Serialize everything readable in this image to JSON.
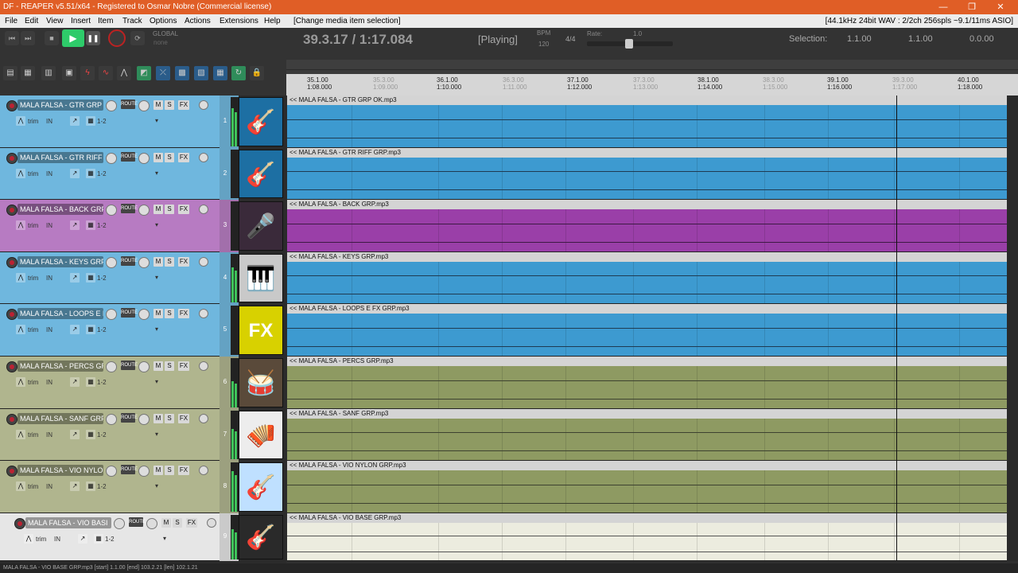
{
  "window": {
    "title": "DF - REAPER v5.51/x64 - Registered to Osmar Nobre (Commercial license)",
    "minimize": "—",
    "maximize": "❐",
    "close": "✕"
  },
  "menu": {
    "items": [
      "File",
      "Edit",
      "View",
      "Insert",
      "Item",
      "Track",
      "Options",
      "Actions",
      "Extensions",
      "Help",
      "[Change media item selection]"
    ],
    "audio_info": "[44.1kHz 24bit WAV : 2/2ch 256spls ~9.1/11ms ASIO]"
  },
  "transport": {
    "position": "39.3.17 / 1:17.084",
    "state": "[Playing]",
    "bpm_label": "BPM",
    "bpm": "120",
    "time_sig": "4/4",
    "rate_label": "Rate:",
    "rate": "1.0",
    "global_label": "GLOBAL",
    "global_sub": "none",
    "selection_label": "Selection:",
    "sel_start": "1.1.00",
    "sel_end": "1.1.00",
    "sel_len": "0.0.00"
  },
  "ruler": {
    "major": [
      {
        "bar": "35.1.00",
        "time": "1:08.000"
      },
      {
        "bar": "36.1.00",
        "time": "1:10.000"
      },
      {
        "bar": "37.1.00",
        "time": "1:12.000"
      },
      {
        "bar": "38.1.00",
        "time": "1:14.000"
      },
      {
        "bar": "39.1.00",
        "time": "1:16.000"
      },
      {
        "bar": "40.1.00",
        "time": "1:18.000"
      }
    ],
    "minor": [
      {
        "bar": "35.3.00",
        "time": "1:09.000"
      },
      {
        "bar": "36.3.00",
        "time": "1:11.000"
      },
      {
        "bar": "37.3.00",
        "time": "1:13.000"
      },
      {
        "bar": "38.3.00",
        "time": "1:15.000"
      },
      {
        "bar": "39.3.00",
        "time": "1:17.000"
      }
    ]
  },
  "track_ui": {
    "trim": "trim",
    "in": "IN",
    "io": "1-2",
    "m": "M",
    "s": "S",
    "fx": "FX",
    "route": "ROUTE"
  },
  "tracks": [
    {
      "num": "1",
      "name": "MALA FALSA - GTR GRP O",
      "item": "<< MALA FALSA - GTR GRP OK.mp3",
      "color": "#3d9ad0",
      "thumb": "guitar-icon",
      "thumbtext": "🎸",
      "thumbbg": "#1d6fa3"
    },
    {
      "num": "2",
      "name": "MALA FALSA - GTR RIFF G",
      "item": "<< MALA FALSA - GTR RIFF GRP.mp3",
      "color": "#3d9ad0",
      "thumb": "guitar-icon",
      "thumbtext": "🎸",
      "thumbbg": "#1d6fa3"
    },
    {
      "num": "3",
      "name": "MALA FALSA - BACK GRP",
      "item": "<< MALA FALSA - BACK GRP.mp3",
      "color": "#9a3fa8",
      "thumb": "microphone-icon",
      "thumbtext": "🎤",
      "thumbbg": "#3a2a3a"
    },
    {
      "num": "4",
      "name": "MALA FALSA - KEYS GRP",
      "item": "<< MALA FALSA - KEYS GRP.mp3",
      "color": "#3d9ad0",
      "thumb": "keyboard-icon",
      "thumbtext": "🎹",
      "thumbbg": "#c9c9c9"
    },
    {
      "num": "5",
      "name": "MALA FALSA - LOOPS E FX",
      "item": "<< MALA FALSA - LOOPS E FX GRP.mp3",
      "color": "#3d9ad0",
      "thumb": "fx-icon",
      "thumbtext": "FX",
      "thumbbg": "#d8d100"
    },
    {
      "num": "6",
      "name": "MALA FALSA - PERCS GRP",
      "item": "<< MALA FALSA - PERCS GRP.mp3",
      "color": "#8e9a62",
      "thumb": "drum-icon",
      "thumbtext": "🥁",
      "thumbbg": "#5a4a3a"
    },
    {
      "num": "7",
      "name": "MALA FALSA - SANF GRP",
      "item": "<< MALA FALSA - SANF GRP.mp3",
      "color": "#8e9a62",
      "thumb": "accordion-icon",
      "thumbtext": "🪗",
      "thumbbg": "#ededed"
    },
    {
      "num": "8",
      "name": "MALA FALSA - VIO NYLON",
      "item": "<< MALA FALSA - VIO NYLON GRP.mp3",
      "color": "#8e9a62",
      "thumb": "acoustic-guitar-icon",
      "thumbtext": "🎸",
      "thumbbg": "#bfe0ff"
    },
    {
      "num": "9",
      "name": "MALA FALSA - VIO BASI",
      "item": "<< MALA FALSA - VIO BASE GRP.mp3",
      "color": "#ececdf",
      "thumb": "guitar-icon",
      "thumbtext": "🎸",
      "thumbbg": "#2a2a2a"
    }
  ],
  "status": "MALA FALSA - VIO BASE GRP.mp3 [start] 1.1.00 [end] 103.2.21 [len] 102.1.21"
}
